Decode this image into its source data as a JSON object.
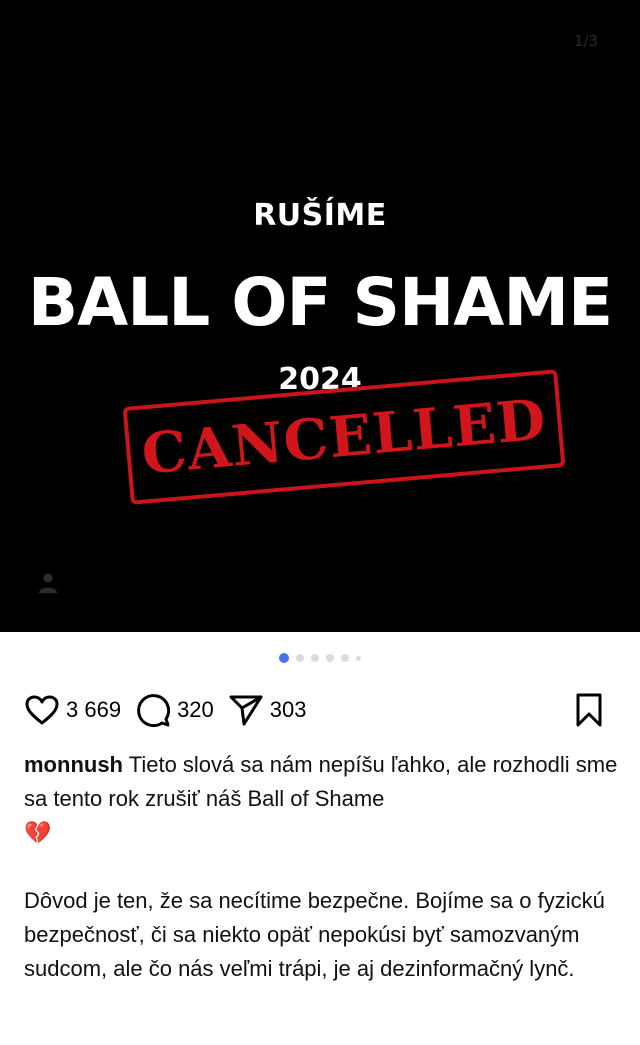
{
  "post_image": {
    "counter": "1/3",
    "kicker": "RUŠÍME",
    "headline": "BALL OF SHAME",
    "year": "2024",
    "stamp": "CANCELLED",
    "stamp_color": "#d0151b"
  },
  "carousel": {
    "total": 6,
    "active_index": 0
  },
  "actions": {
    "likes": "3 669",
    "comments": "320",
    "shares": "303"
  },
  "caption": {
    "username": "monnush",
    "text1": "Tieto slová sa nám nepíšu ľahko, ale rozhodli sme sa tento rok zrušiť náš Ball of Shame",
    "emoji": "💔",
    "text2": "Dôvod je ten, že sa necítime bezpečne. Bojíme sa o fyzickú bezpečnosť, či sa niekto opäť nepokúsi byť samozvaným sudcom, ale čo nás veľmi trápi, je aj dezinformačný lynč."
  },
  "colors": {
    "accent": "#4a6ff0",
    "background": "#ffffff",
    "image_bg": "#000000"
  }
}
